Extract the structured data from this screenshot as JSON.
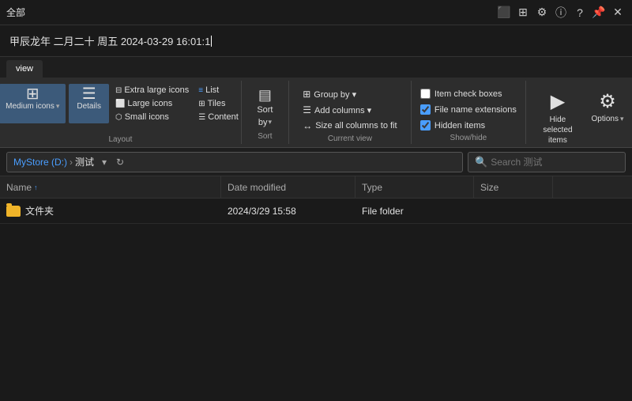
{
  "titlebar": {
    "title": "全部",
    "icons": [
      "monitor-icon",
      "qr-icon",
      "gear-icon",
      "info-icon",
      "help-icon",
      "pin-icon",
      "close-icon"
    ]
  },
  "clock": {
    "text": "甲辰龙年 二月二十 周五 2024-03-29 16:01:1"
  },
  "ribbon": {
    "active_tab": "view",
    "tabs": [
      "view"
    ],
    "groups": {
      "layout": {
        "label": "Layout",
        "items": [
          {
            "id": "extra-large-icons",
            "label": "Extra large icons"
          },
          {
            "id": "large-icons",
            "label": "Large icons"
          },
          {
            "id": "small-icons",
            "label": "Small icons"
          },
          {
            "id": "list",
            "label": "List"
          },
          {
            "id": "medium-icons",
            "label": "Medium icons",
            "selected": true
          },
          {
            "id": "details",
            "label": "Details",
            "selected": false
          },
          {
            "id": "tiles",
            "label": "Tiles"
          },
          {
            "id": "content",
            "label": "Content"
          }
        ]
      },
      "sort": {
        "label": "Sort",
        "button_label": "Sort\nby"
      },
      "current_view": {
        "label": "Current view",
        "items": [
          {
            "label": "Group by ▾"
          },
          {
            "label": "Add columns ▾"
          },
          {
            "label": "Size all columns to fit"
          }
        ]
      },
      "show_hide": {
        "label": "Show/hide",
        "checkboxes": [
          {
            "label": "Item check boxes",
            "checked": false
          },
          {
            "label": "File name extensions",
            "checked": true
          },
          {
            "label": "Hidden items",
            "checked": true
          }
        ]
      },
      "actions": {
        "hide_selected": {
          "icon": "▶",
          "label": "Hide selected\nitems"
        },
        "options": {
          "icon": "⚙",
          "label": "Options"
        }
      }
    }
  },
  "navigation": {
    "path_parts": [
      "MyStore (D:)",
      "测试"
    ],
    "path_separator": "›",
    "search_placeholder": "Search 测试"
  },
  "file_list": {
    "columns": [
      {
        "id": "name",
        "label": "Name",
        "sort_indicator": "↑"
      },
      {
        "id": "date_modified",
        "label": "Date modified"
      },
      {
        "id": "type",
        "label": "Type"
      },
      {
        "id": "size",
        "label": "Size"
      }
    ],
    "rows": [
      {
        "name": "文件夹",
        "date_modified": "2024/3/29 15:58",
        "type": "File folder",
        "size": "",
        "icon": "folder"
      }
    ]
  }
}
